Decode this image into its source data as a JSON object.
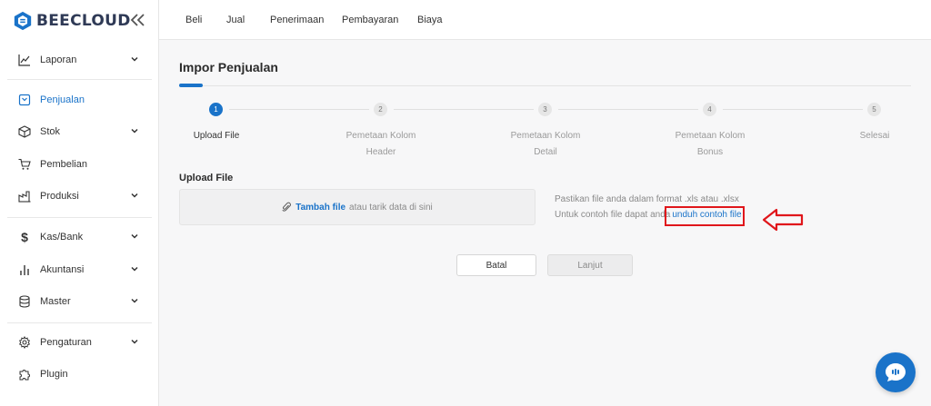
{
  "app": {
    "brand": "BEECLOUD"
  },
  "sidebar": {
    "items": [
      {
        "label": "Laporan",
        "icon": "chart-line-icon",
        "has_submenu": true
      },
      {
        "label": "Penjualan",
        "icon": "sales-icon",
        "active": true
      },
      {
        "label": "Stok",
        "icon": "box-icon",
        "has_submenu": true
      },
      {
        "label": "Pembelian",
        "icon": "cart-icon"
      },
      {
        "label": "Produksi",
        "icon": "factory-icon",
        "has_submenu": true
      },
      {
        "label": "Kas/Bank",
        "icon": "dollar-icon",
        "has_submenu": true
      },
      {
        "label": "Akuntansi",
        "icon": "bar-chart-icon",
        "has_submenu": true
      },
      {
        "label": "Master",
        "icon": "database-icon",
        "has_submenu": true
      },
      {
        "label": "Pengaturan",
        "icon": "gear-icon",
        "has_submenu": true
      },
      {
        "label": "Plugin",
        "icon": "puzzle-icon"
      }
    ]
  },
  "topnav": [
    "Beli",
    "Jual",
    "Penerimaan",
    "Pembayaran",
    "Biaya"
  ],
  "page": {
    "title": "Impor Penjualan"
  },
  "steps": [
    {
      "number": "1",
      "label_line1": "Upload File",
      "label_line2": "",
      "active": true
    },
    {
      "number": "2",
      "label_line1": "Pemetaan Kolom",
      "label_line2": "Header"
    },
    {
      "number": "3",
      "label_line1": "Pemetaan Kolom",
      "label_line2": "Detail"
    },
    {
      "number": "4",
      "label_line1": "Pemetaan Kolom",
      "label_line2": "Bonus"
    },
    {
      "number": "5",
      "label_line1": "Selesai",
      "label_line2": ""
    }
  ],
  "upload": {
    "section_label": "Upload File",
    "add_file": "Tambah file",
    "drop_hint": "atau tarik data di sini",
    "info_line1": "Pastikan file anda dalam format .xls atau .xlsx",
    "info_line2": "Untuk contoh file dapat anda",
    "download_link": "unduh contoh file"
  },
  "buttons": {
    "cancel": "Batal",
    "next": "Lanjut"
  },
  "colors": {
    "accent": "#1a73c9",
    "annotation": "#e0161b"
  }
}
